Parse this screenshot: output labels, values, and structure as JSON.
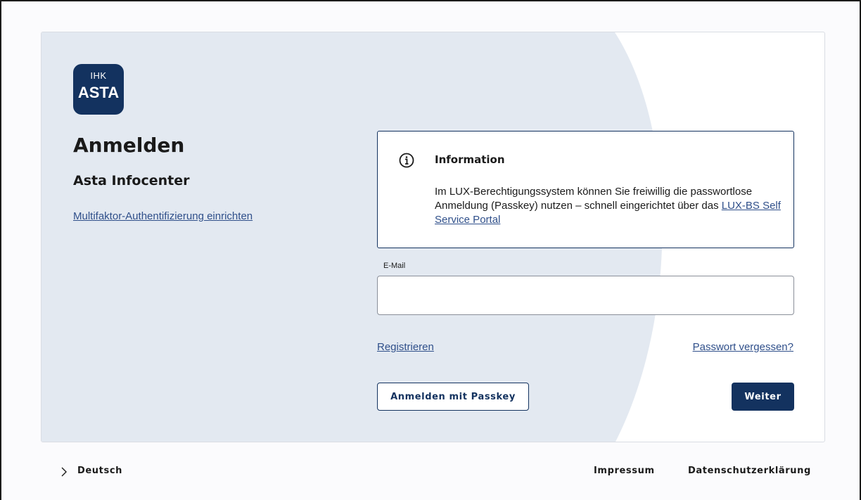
{
  "logo": {
    "top": "IHK",
    "bottom": "ASTA"
  },
  "heading": {
    "title": "Anmelden",
    "subtitle": "Asta Infocenter"
  },
  "links": {
    "mfa": "Multifaktor-Authentifizierung einrichten",
    "register": "Registrieren",
    "forgot_password": "Passwort vergessen?"
  },
  "info": {
    "icon": "info-icon",
    "heading": "Information",
    "text_before": "Im LUX-Berechtigungssystem können Sie freiwillig die passwortlose Anmeldung (Passkey) nutzen – schnell eingerichtet über das ",
    "link": "LUX-BS Self Service Portal"
  },
  "email": {
    "label": "E-Mail",
    "value": "",
    "placeholder": ""
  },
  "buttons": {
    "passkey": "Anmelden mit Passkey",
    "next": "Weiter"
  },
  "footer": {
    "language_icon": "chevron-right-icon",
    "language": "Deutsch",
    "impressum": "Impressum",
    "privacy": "Datenschutzerklärung"
  },
  "colors": {
    "primary": "#13325f",
    "link": "#2f4f8a",
    "panel": "#e3e9f1",
    "border": "#d9dde3"
  }
}
